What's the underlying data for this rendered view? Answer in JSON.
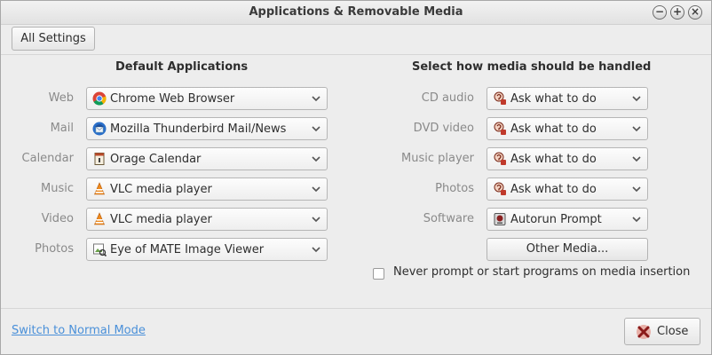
{
  "window": {
    "title": "Applications & Removable Media",
    "controls": [
      "minimize-icon",
      "maximize-icon",
      "close-icon"
    ]
  },
  "toolbar": {
    "all_settings_label": "All Settings"
  },
  "default_apps": {
    "heading": "Default Applications",
    "rows": [
      {
        "label": "Web",
        "value": "Chrome Web Browser",
        "icon": "chrome-icon"
      },
      {
        "label": "Mail",
        "value": "Mozilla Thunderbird Mail/News",
        "icon": "thunderbird-icon"
      },
      {
        "label": "Calendar",
        "value": "Orage Calendar",
        "icon": "calendar-icon"
      },
      {
        "label": "Music",
        "value": "VLC media player",
        "icon": "vlc-icon"
      },
      {
        "label": "Video",
        "value": "VLC media player",
        "icon": "vlc-icon"
      },
      {
        "label": "Photos",
        "value": "Eye of MATE Image Viewer",
        "icon": "image-viewer-icon"
      }
    ]
  },
  "media": {
    "heading": "Select how media should be handled",
    "rows": [
      {
        "label": "CD audio",
        "value": "Ask what to do",
        "icon": "ask-icon"
      },
      {
        "label": "DVD video",
        "value": "Ask what to do",
        "icon": "ask-icon"
      },
      {
        "label": "Music player",
        "value": "Ask what to do",
        "icon": "ask-icon"
      },
      {
        "label": "Photos",
        "value": "Ask what to do",
        "icon": "ask-icon"
      },
      {
        "label": "Software",
        "value": "Autorun Prompt",
        "icon": "autorun-icon"
      }
    ],
    "other_media_label": "Other Media...",
    "never_prompt_label": "Never prompt or start programs on media insertion",
    "never_prompt_checked": false
  },
  "footer": {
    "switch_mode_label": "Switch to Normal Mode",
    "close_label": "Close"
  },
  "colors": {
    "link": "#4a90d9",
    "label_gray": "#8a8a8a"
  }
}
